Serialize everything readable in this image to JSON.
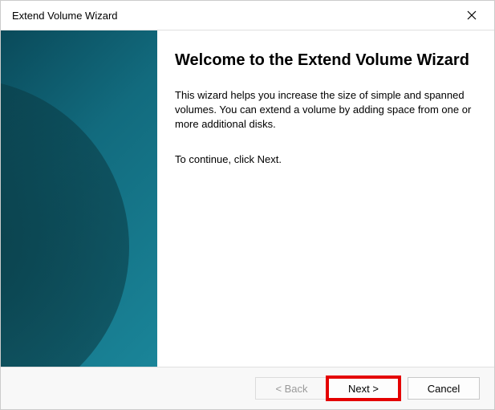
{
  "titlebar": {
    "title": "Extend Volume Wizard"
  },
  "main": {
    "heading": "Welcome to the Extend Volume Wizard",
    "description": "This wizard helps you increase the size of simple and spanned volumes. You can extend a volume  by adding space from one or more additional disks.",
    "continue_text": "To continue, click Next."
  },
  "buttons": {
    "back": "< Back",
    "next": "Next >",
    "cancel": "Cancel"
  }
}
